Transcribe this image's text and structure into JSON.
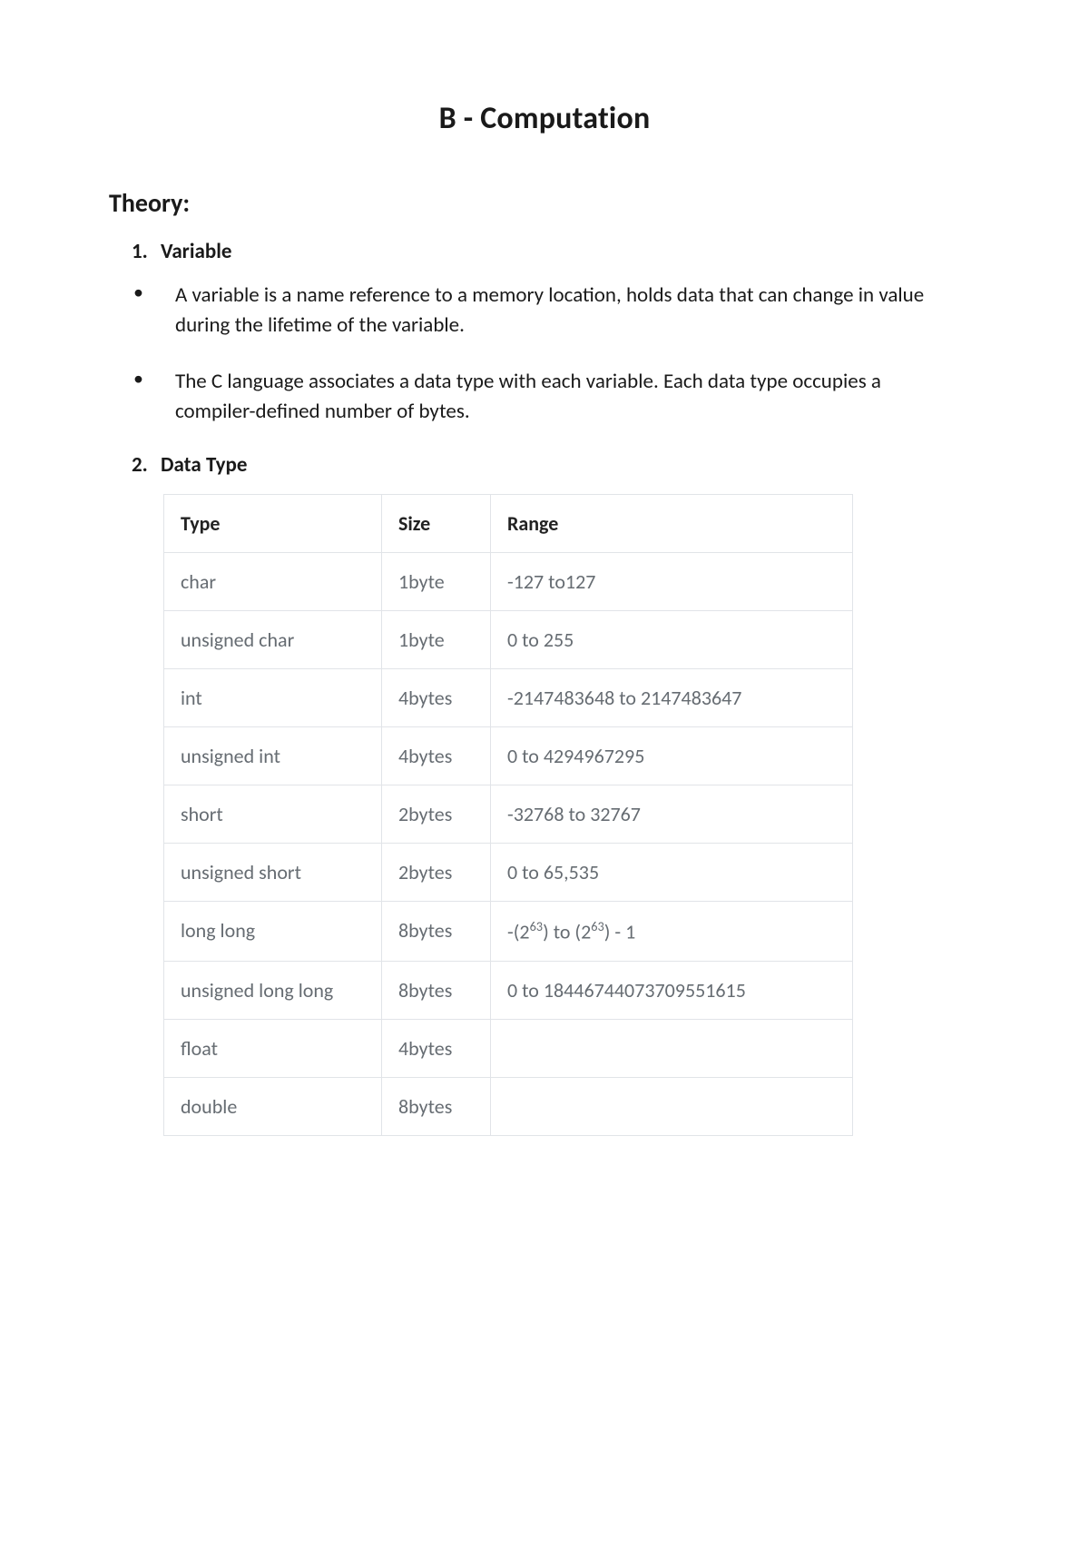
{
  "title": "B - Computation",
  "section_heading": "Theory:",
  "items": [
    {
      "number": "1.",
      "label": "Variable"
    },
    {
      "number": "2.",
      "label": "Data Type"
    }
  ],
  "bullets": [
    "A variable is a name reference to a memory location, holds data that can change in value during the lifetime of the variable.",
    "The C language associates a data type with each variable.  Each data type occupies a compiler-defined number of bytes."
  ],
  "table": {
    "headers": {
      "type": "Type",
      "size": "Size",
      "range": "Range"
    },
    "rows": [
      {
        "type": "char",
        "size": "1byte",
        "range": "-127 to127"
      },
      {
        "type": "unsigned char",
        "size": "1byte",
        "range": "0 to 255"
      },
      {
        "type": "int",
        "size": "4bytes",
        "range": "-2147483648 to 2147483647"
      },
      {
        "type": "unsigned int",
        "size": "4bytes",
        "range": "0 to 4294967295"
      },
      {
        "type": "short",
        "size": "2bytes",
        "range": "-32768 to 32767"
      },
      {
        "type": "unsigned short",
        "size": "2bytes",
        "range": "0 to 65,535"
      },
      {
        "type": "long long",
        "size": "8bytes",
        "range_html": "-(2<sup>63</sup>) to (2<sup>63</sup>) - 1"
      },
      {
        "type": "unsigned long long",
        "size": "8bytes",
        "range": "0 to 18446744073709551615"
      },
      {
        "type": "float",
        "size": "4bytes",
        "range": ""
      },
      {
        "type": "double",
        "size": "8bytes",
        "range": ""
      }
    ]
  }
}
